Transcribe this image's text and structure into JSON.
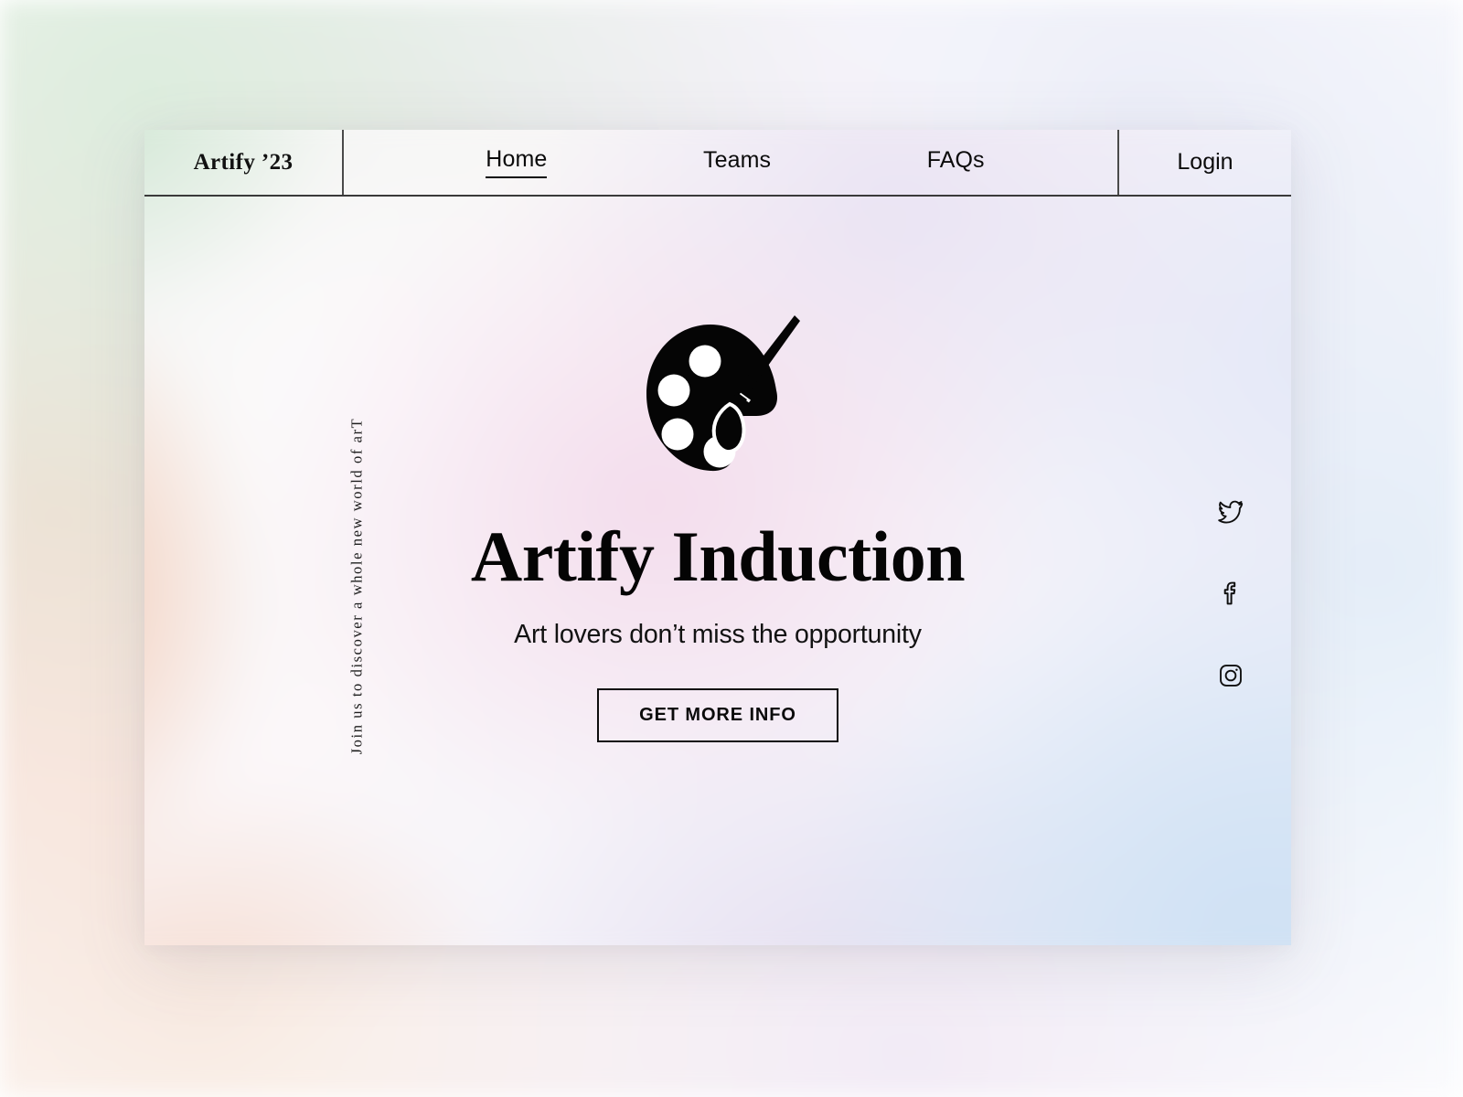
{
  "brand": {
    "logo_text": "Artify ’23"
  },
  "nav": {
    "items": [
      {
        "label": "Home",
        "active": true
      },
      {
        "label": "Teams",
        "active": false
      },
      {
        "label": "FAQs",
        "active": false
      }
    ],
    "login_label": "Login"
  },
  "hero": {
    "vertical_tagline": "Join  us to discover a whole new world of arT",
    "logo_icon": "paint-palette-icon",
    "title": "Artify Induction",
    "subtitle": "Art lovers don’t miss the opportunity",
    "cta_label": "GET MORE INFO"
  },
  "social": {
    "items": [
      {
        "name": "twitter-icon"
      },
      {
        "name": "facebook-icon"
      },
      {
        "name": "instagram-icon"
      }
    ]
  },
  "colors": {
    "text": "#0b0b0b",
    "border": "#3a3a3a",
    "bg_mint": "#cfe6d2",
    "bg_peach": "#f2c9b4",
    "bg_pink": "#f3dcec",
    "bg_lavender": "#e9e3f3",
    "bg_blue": "#cfe1f4",
    "card_white": "#ffffff"
  }
}
